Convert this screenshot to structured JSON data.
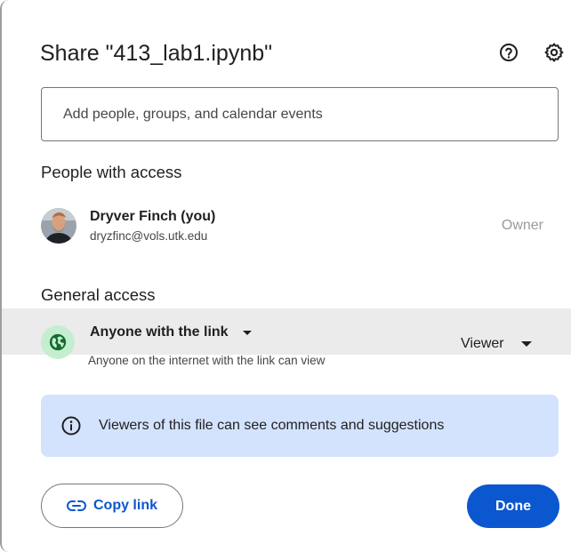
{
  "dialog": {
    "title": "Share \"413_lab1.ipynb\"",
    "help_icon": "help-circle-icon",
    "settings_icon": "gear-icon"
  },
  "add_people": {
    "placeholder": "Add people, groups, and calendar events",
    "value": ""
  },
  "people_with_access": {
    "heading": "People with access",
    "people": [
      {
        "name": "Dryver Finch (you)",
        "email": "dryzfinc@vols.utk.edu",
        "role": "Owner",
        "avatar": "user-avatar"
      }
    ]
  },
  "general_access": {
    "heading": "General access",
    "scope": "Anyone with the link",
    "description": "Anyone on the internet with the link can view",
    "role": "Viewer",
    "icon": "globe-icon"
  },
  "info_banner": {
    "text": "Viewers of this file can see comments and suggestions",
    "icon": "info-icon"
  },
  "footer": {
    "copy_link_label": "Copy link",
    "copy_link_icon": "link-icon",
    "done_label": "Done"
  },
  "colors": {
    "primary": "#0b57d0",
    "banner_bg": "#d3e3fd",
    "globe_bg": "#c4eed0",
    "globe_fg": "#146c2e",
    "access_row_bg": "#ebebeb"
  }
}
